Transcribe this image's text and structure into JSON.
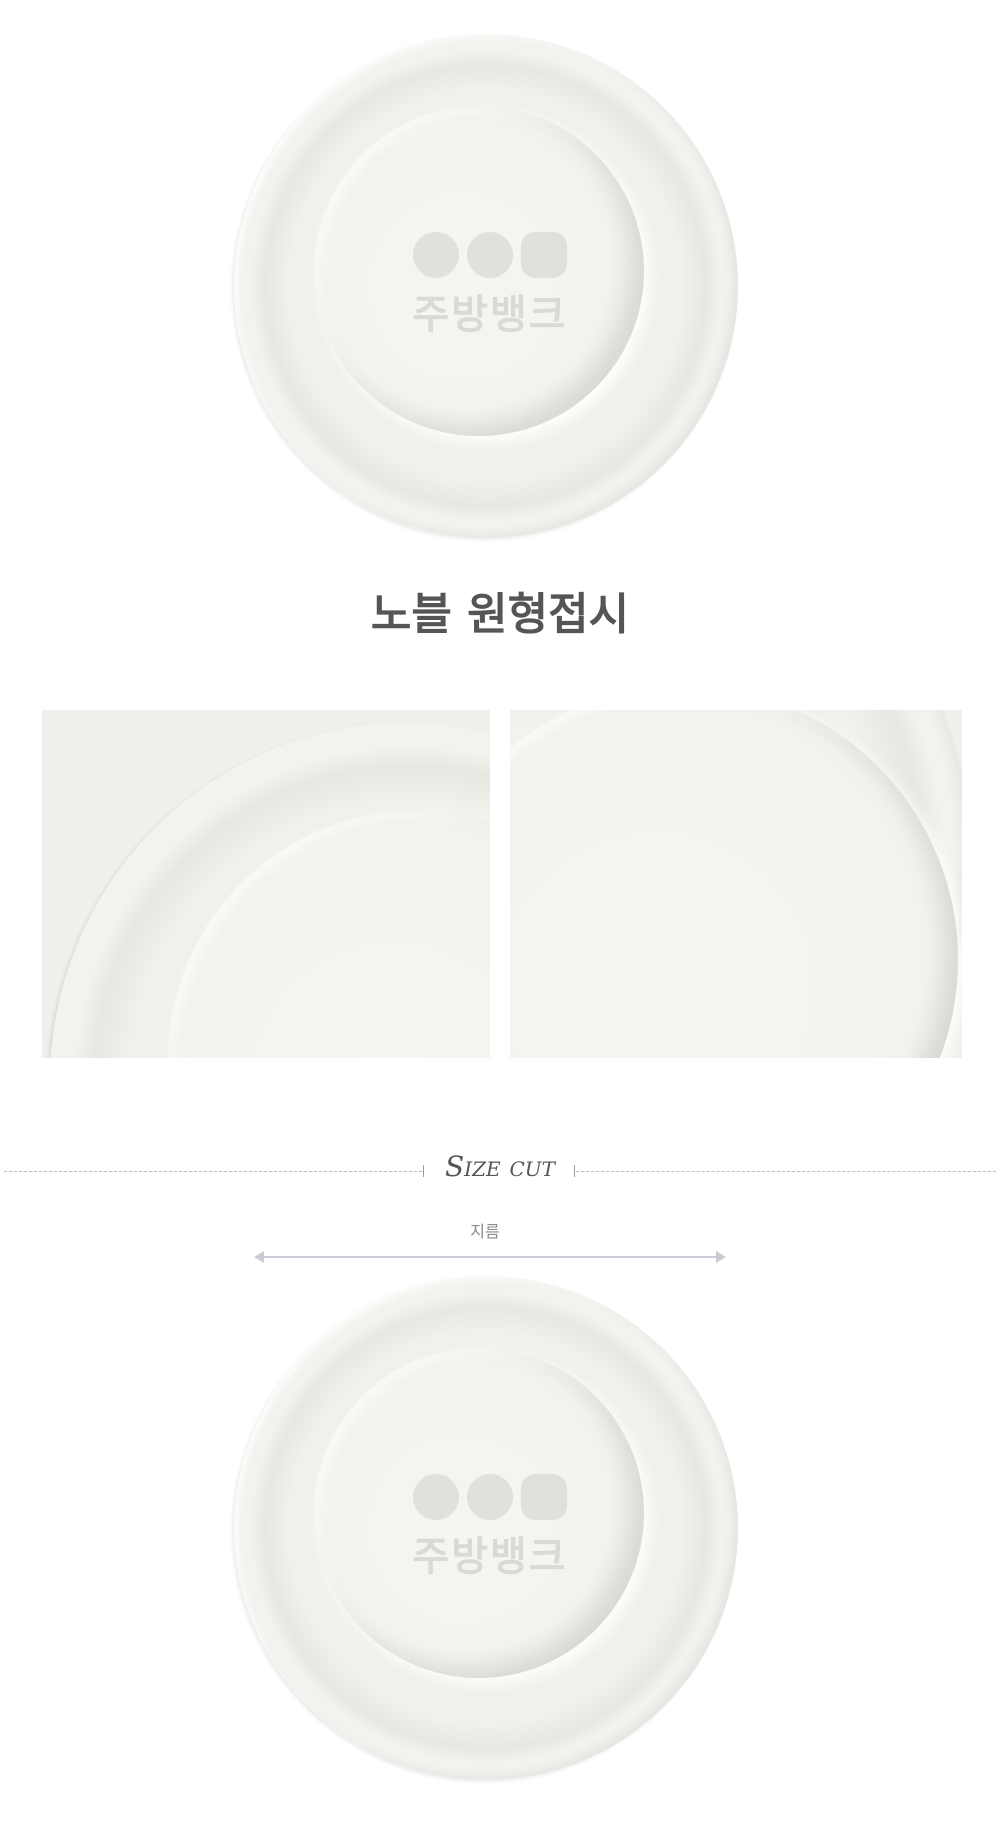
{
  "product": {
    "title": "노블 원형접시"
  },
  "watermark": {
    "text": "주방뱅크"
  },
  "size_section": {
    "label": "Size cut",
    "dimension_label": "지름"
  }
}
